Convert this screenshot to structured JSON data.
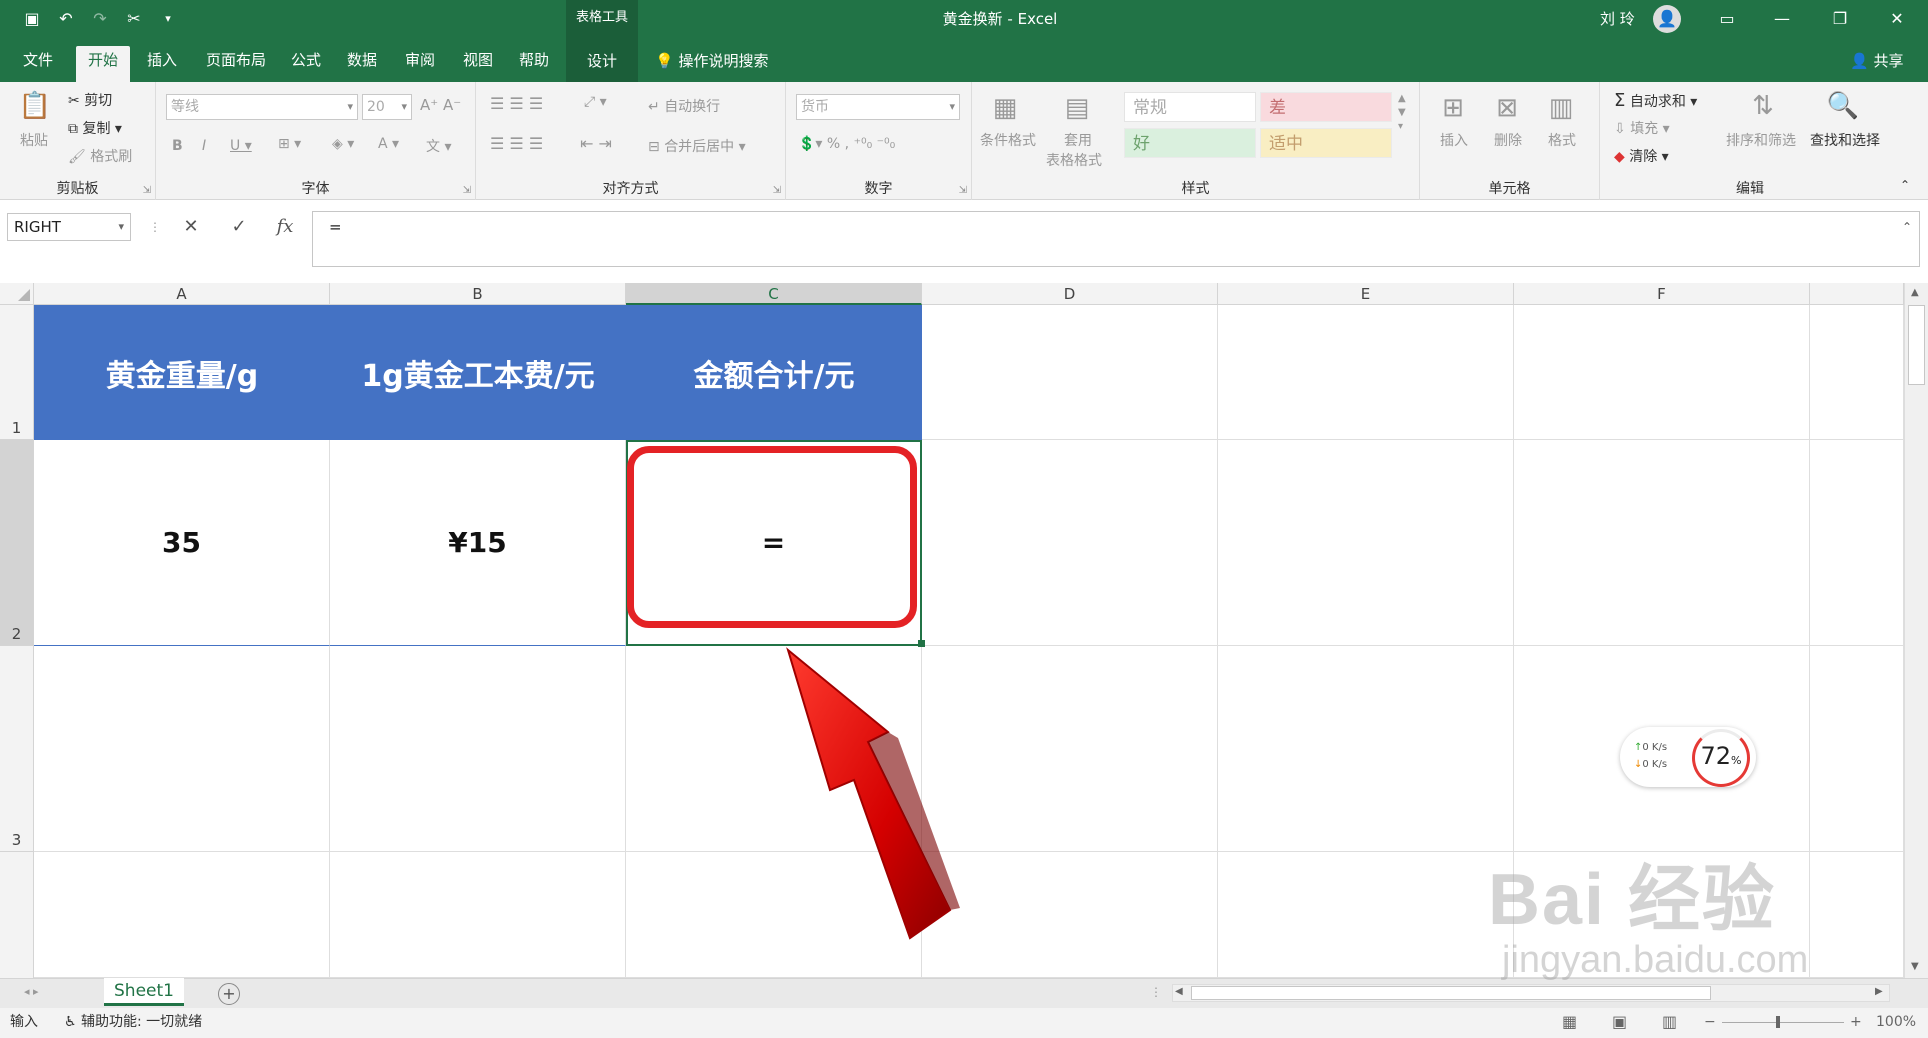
{
  "titlebar": {
    "table_tools": "表格工具",
    "document_title": "黄金换新  -  Excel",
    "user_name": "刘 玲"
  },
  "tabs": {
    "file": "文件",
    "home": "开始",
    "insert": "插入",
    "page_layout": "页面布局",
    "formulas": "公式",
    "data": "数据",
    "review": "审阅",
    "view": "视图",
    "help": "帮助",
    "design": "设计",
    "tell_me": "操作说明搜索",
    "share": "共享"
  },
  "ribbon": {
    "clipboard": {
      "label": "剪贴板",
      "paste": "粘贴",
      "cut": "剪切",
      "copy": "复制",
      "format_painter": "格式刷"
    },
    "font": {
      "label": "字体",
      "font_name": "等线",
      "font_size": "20"
    },
    "alignment": {
      "label": "对齐方式",
      "wrap_text": "自动换行",
      "merge_center": "合并后居中"
    },
    "number": {
      "label": "数字",
      "format": "货币"
    },
    "styles": {
      "label": "样式",
      "conditional": "条件格式",
      "format_table_1": "套用",
      "format_table_2": "表格格式",
      "normal": "常规",
      "bad": "差",
      "good": "好",
      "neutral": "适中"
    },
    "cells": {
      "label": "单元格",
      "insert": "插入",
      "delete": "删除",
      "format": "格式"
    },
    "editing": {
      "label": "编辑",
      "autosum": "自动求和",
      "fill": "填充",
      "clear": "清除",
      "sort_filter": "排序和筛选",
      "find_select": "查找和选择"
    }
  },
  "formula_bar": {
    "name_box": "RIGHT",
    "formula": "="
  },
  "columns": [
    "A",
    "B",
    "C",
    "D",
    "E",
    "F"
  ],
  "rows": [
    "1",
    "2",
    "3"
  ],
  "table": {
    "headers": [
      "黄金重量/g",
      "1g黄金工本费/元",
      "金额合计/元"
    ],
    "values": [
      "35",
      "¥15",
      "="
    ]
  },
  "sheet": {
    "tab_name": "Sheet1"
  },
  "status": {
    "mode": "输入",
    "accessibility": "辅助功能: 一切就绪",
    "zoom": "100%"
  },
  "net_widget": {
    "up": "0  K/s",
    "down": "0  K/s",
    "percent": "72",
    "percent_sign": "%"
  },
  "watermark": {
    "brand": "Bai 经验",
    "url": "jingyan.baidu.com"
  },
  "colors": {
    "excel_green": "#217346",
    "header_blue": "#4472c4",
    "highlight_red": "#e42225"
  }
}
